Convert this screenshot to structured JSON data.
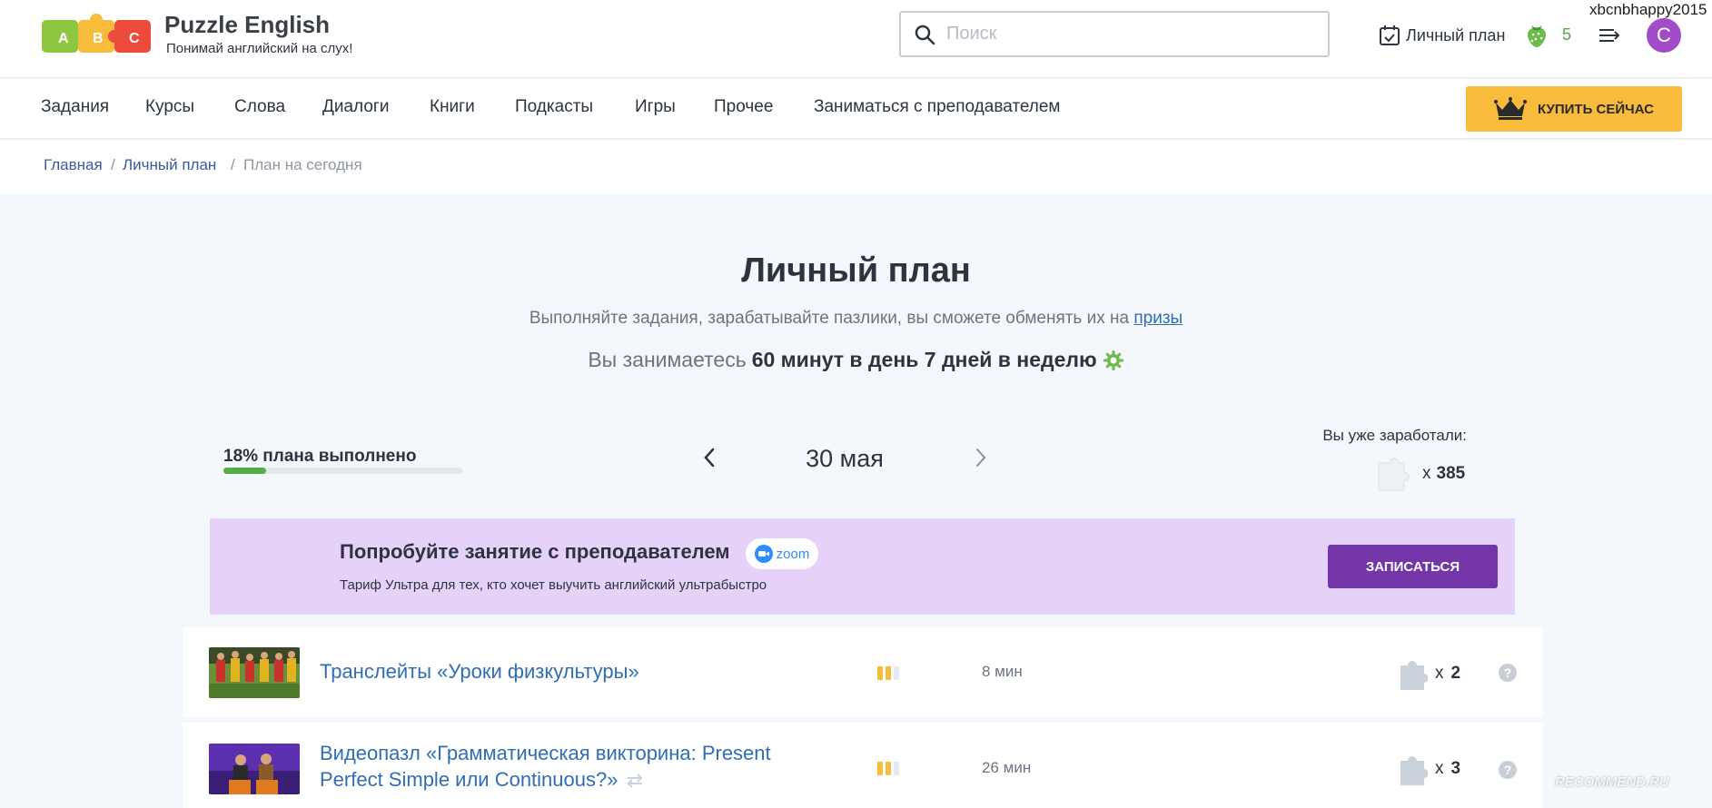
{
  "user": {
    "username": "xbcnbhappy2015",
    "avatar_letter": "С"
  },
  "brand": {
    "name": "Puzzle English",
    "tagline": "Понимай английский на слух!",
    "logo_letters": [
      "A",
      "B",
      "C"
    ]
  },
  "search": {
    "placeholder": "Поиск"
  },
  "header": {
    "plan_label": "Личный план",
    "berries": "5"
  },
  "nav": {
    "items": [
      "Задания",
      "Курсы",
      "Слова",
      "Диалоги",
      "Книги",
      "Подкасты",
      "Игры",
      "Прочее",
      "Заниматься с преподавателем"
    ],
    "buy_label": "КУПИТЬ СЕЙЧАС"
  },
  "breadcrumb": {
    "items": [
      "Главная",
      "Личный план",
      "План на сегодня"
    ],
    "separator": "/"
  },
  "page": {
    "title": "Личный план",
    "subtitle": "Выполняйте задания, зарабатывайте пазлики, вы сможете обменять их на",
    "subtitle_link": "призы",
    "schedule_prefix": "Вы занимаетесь",
    "schedule_bold": "60 минут в день 7 дней в неделю"
  },
  "progress": {
    "label": "18% плана выполнено",
    "value": 0.18
  },
  "date": {
    "label": "30 мая"
  },
  "earned": {
    "label": "Вы уже заработали:",
    "times": "x",
    "count": "385"
  },
  "promo": {
    "title": "Попробуйте занятие с преподавателем",
    "badge": "zoom",
    "subtitle": "Тариф Ультра для тех, кто хочет выучить английский ультрабыстро",
    "button": "ЗАПИСАТЬСЯ"
  },
  "tasks": [
    {
      "title": "Транслейты «Уроки физкультуры»",
      "duration": "8 мин",
      "times": "x",
      "reward": "2",
      "help": "?",
      "difficulty": 2
    },
    {
      "title": "Видеопазл «Грамматическая викторина: Present Perfect Simple или Continuous?»",
      "duration": "26 мин",
      "times": "x",
      "reward": "3",
      "help": "?",
      "difficulty": 2
    }
  ],
  "colors": {
    "accent": "#f8bb3c",
    "link": "#2f6eb3",
    "promo_bg": "#e6d1f9",
    "promo_btn": "#7435a8",
    "progress": "#56ae46",
    "berry": "#53a93f"
  },
  "watermark": "RECOMMEND.RU"
}
